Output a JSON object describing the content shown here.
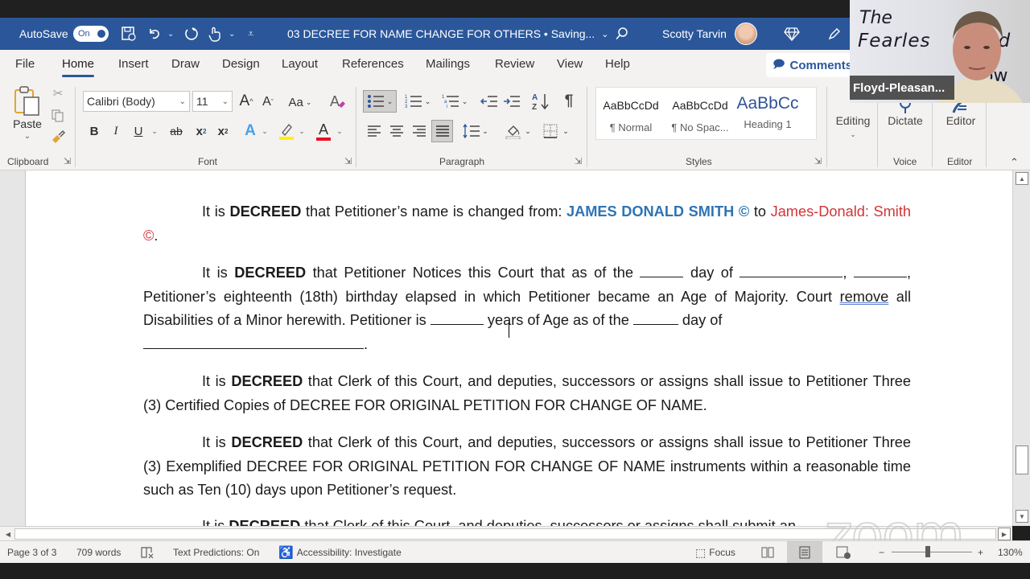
{
  "titlebar": {
    "autosave_label": "AutoSave",
    "autosave_state": "On",
    "document_title": "03 DECREE FOR NAME CHANGE FOR OTHERS • Saving...",
    "user_name": "Scotty Tarvin",
    "icons": [
      "save-icon",
      "undo-icon",
      "redo-icon",
      "touch-mode-icon",
      "customize-qat-icon",
      "search-icon",
      "diamond-icon",
      "pen-icon"
    ]
  },
  "ribbon_tabs": [
    "File",
    "Home",
    "Insert",
    "Draw",
    "Design",
    "Layout",
    "References",
    "Mailings",
    "Review",
    "View",
    "Help"
  ],
  "active_tab": "Home",
  "comments_label": "Comments",
  "ribbon": {
    "clipboard": {
      "paste_label": "Paste",
      "group_label": "Clipboard"
    },
    "font": {
      "font_name": "Calibri (Body)",
      "font_size": "11",
      "group_label": "Font",
      "grow": "A",
      "shrink": "A",
      "change_case": "Aa",
      "bold": "B",
      "italic": "I",
      "underline": "U",
      "strike": "ab",
      "subscript": "x",
      "superscript": "x",
      "text_effects": "A",
      "font_color": "A",
      "highlight_color": "#fff200",
      "font_color_value": "#e81123"
    },
    "paragraph": {
      "group_label": "Paragraph",
      "pilcrow": "¶"
    },
    "styles": {
      "group_label": "Styles",
      "items": [
        {
          "sample": "AaBbCcDd",
          "name": "¶ Normal"
        },
        {
          "sample": "AaBbCcDd",
          "name": "¶ No Spac..."
        },
        {
          "sample": "AaBbCc",
          "name": "Heading 1"
        }
      ]
    },
    "editing": {
      "label": "Editing"
    },
    "voice": {
      "label": "Dictate",
      "group_label": "Voice"
    },
    "editor": {
      "label": "Editor",
      "group_label": "Editor"
    }
  },
  "video_overlay": {
    "participant_name": "Floyd-Pleasan...",
    "backdrop_line1": "The",
    "backdrop_line2": "Fearles",
    "backdrop_line2b": "yd",
    "backdrop_line3": "ow"
  },
  "document": {
    "p1": {
      "lead": "It is ",
      "bold": "DECREED",
      "text": " that Petitioner’s name is changed from: ",
      "name_from": "JAMES DONALD SMITH ©",
      "to": " to ",
      "name_to": "James-Donald: Smith ©",
      "end": "."
    },
    "p2": {
      "lead": "It is ",
      "bold": "DECREED",
      "text1": " that Petitioner Notices this Court that as of the ",
      "text2": " day of ",
      "text3": ", ",
      "text4": ", Petitioner’s eighteenth (18th) birthday elapsed in which Petitioner became an Age of Majority. Court ",
      "underlined": "remove",
      "text5": " all Disabilities of a Minor herewith. Petitioner is ",
      "text6": " years of Age as of the ",
      "text7": " day of ",
      "text8": "."
    },
    "p3": {
      "lead": "It is ",
      "bold": "DECREED",
      "text": " that Clerk of this Court, and deputies, successors or assigns shall issue to Petitioner Three (3) Certified Copies of DECREE FOR ORIGINAL PETITION FOR CHANGE OF NAME."
    },
    "p4": {
      "lead": "It is ",
      "bold": "DECREED",
      "text": " that Clerk of this Court, and deputies, successors or assigns shall issue to Petitioner Three (3) Exemplified DECREE FOR ORIGINAL PETITION FOR CHANGE OF NAME instruments within a reasonable time such as Ten (10) days upon Petitioner’s request."
    },
    "p5": {
      "lead": "It is ",
      "bold": "DECREED",
      "text": " that Clerk of this Court, and deputies, successors or assigns shall submit an"
    }
  },
  "statusbar": {
    "page": "Page 3 of 3",
    "words": "709 words",
    "text_predictions": "Text Predictions: On",
    "accessibility": "Accessibility: Investigate",
    "focus": "Focus",
    "zoom_level": "130%",
    "zoom_minus": "−",
    "zoom_plus": "+"
  },
  "watermark": "zoom"
}
